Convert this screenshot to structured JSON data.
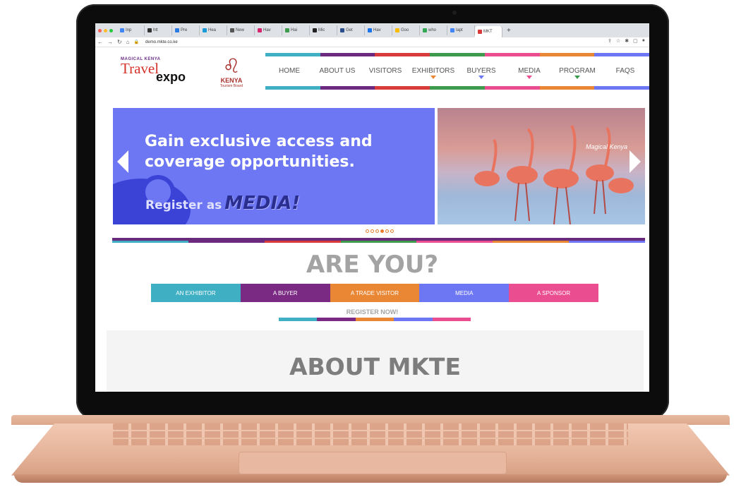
{
  "browser": {
    "tabs": [
      "Inp",
      "htt",
      "Pre",
      "Hea",
      "New",
      "Hav",
      "Hai",
      "Mic",
      "Get",
      "Hav",
      "Goo",
      "who",
      "lapt",
      "MKT"
    ],
    "url": "demo.mkte.co.ke"
  },
  "logo": {
    "tagline": "MAGICAL KENYA",
    "travel": "Travel",
    "expo": "expo"
  },
  "partner": {
    "name": "KENYA",
    "sub": "Tourism Board"
  },
  "nav": {
    "items": [
      "HOME",
      "ABOUT US",
      "VISITORS",
      "EXHIBITORS",
      "BUYERS",
      "MEDIA",
      "PROGRAM",
      "FAQS"
    ],
    "bar_colors": [
      "#3fb0c4",
      "#6b2a80",
      "#d93a3a",
      "#3e9b4d",
      "#ea4e91",
      "#ea8734",
      "#6e77f3"
    ],
    "caret_colors": [
      "#ea8734",
      "#6e77f3",
      "#ea4e91",
      "#3e9b4d"
    ]
  },
  "slide": {
    "headline": "Gain exclusive access and coverage opportunities.",
    "register": "Register as",
    "highlight": "MEDIA!",
    "badge": "Magical Kenya"
  },
  "are_you": {
    "title": "ARE YOU?",
    "roles": [
      {
        "label": "AN EXHIBITOR",
        "color": "#3fb0c4"
      },
      {
        "label": "A BUYER",
        "color": "#7a2a82"
      },
      {
        "label": "A TRADE VISITOR",
        "color": "#ea8734"
      },
      {
        "label": "MEDIA",
        "color": "#6e77f3"
      },
      {
        "label": "A SPONSOR",
        "color": "#ea4e91"
      }
    ],
    "register_now": "REGISTER NOW!"
  },
  "about": {
    "title": "ABOUT MKTE"
  }
}
